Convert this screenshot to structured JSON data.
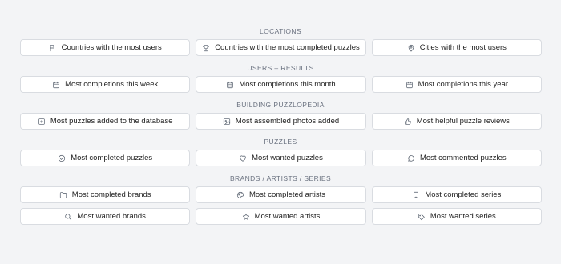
{
  "sections": [
    {
      "title": "LOCATIONS",
      "rows": [
        [
          {
            "label": "Countries with the most users",
            "icon": "flag-icon"
          },
          {
            "label": "Countries with the most completed puzzles",
            "icon": "trophy-icon"
          },
          {
            "label": "Cities with the most users",
            "icon": "map-pin-icon"
          }
        ]
      ]
    },
    {
      "title": "USERS – RESULTS",
      "rows": [
        [
          {
            "label": "Most completions this week",
            "icon": "calendar-icon"
          },
          {
            "label": "Most completions this month",
            "icon": "calendar-grid-icon"
          },
          {
            "label": "Most completions this year",
            "icon": "calendar-icon"
          }
        ]
      ]
    },
    {
      "title": "BUILDING PUZZLOPEDIA",
      "rows": [
        [
          {
            "label": "Most puzzles added to the database",
            "icon": "plus-square-icon"
          },
          {
            "label": "Most assembled photos added",
            "icon": "image-icon"
          },
          {
            "label": "Most helpful puzzle reviews",
            "icon": "thumbs-up-icon"
          }
        ]
      ]
    },
    {
      "title": "PUZZLES",
      "rows": [
        [
          {
            "label": "Most completed puzzles",
            "icon": "check-circle-icon"
          },
          {
            "label": "Most wanted puzzles",
            "icon": "heart-icon"
          },
          {
            "label": "Most commented puzzles",
            "icon": "chat-bubble-icon"
          }
        ]
      ]
    },
    {
      "title": "BRANDS / ARTISTS / SERIES",
      "rows": [
        [
          {
            "label": "Most completed brands",
            "icon": "folder-icon"
          },
          {
            "label": "Most completed artists",
            "icon": "palette-icon"
          },
          {
            "label": "Most completed series",
            "icon": "bookmark-icon"
          }
        ],
        [
          {
            "label": "Most wanted brands",
            "icon": "search-icon"
          },
          {
            "label": "Most wanted artists",
            "icon": "star-icon"
          },
          {
            "label": "Most wanted series",
            "icon": "tags-icon"
          }
        ]
      ]
    }
  ]
}
